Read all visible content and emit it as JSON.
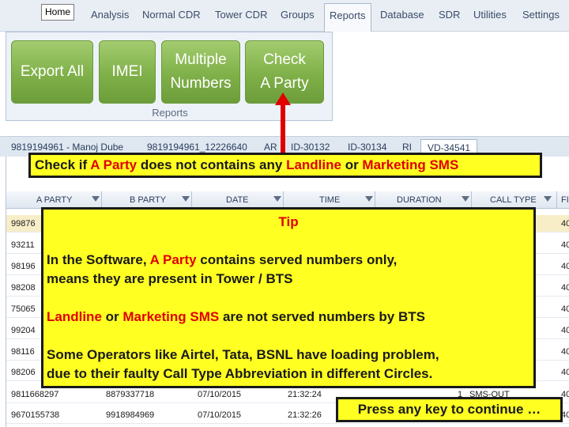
{
  "menu": {
    "home": "Home",
    "items": [
      "Analysis",
      "Normal CDR",
      "Tower CDR",
      "Groups",
      "Reports",
      "Database",
      "SDR",
      "Utilities",
      "Settings"
    ]
  },
  "ribbon": {
    "buttons": [
      {
        "line1": "Export All",
        "line2": ""
      },
      {
        "line1": "IMEI",
        "line2": ""
      },
      {
        "line1": "Multiple",
        "line2": "Numbers"
      },
      {
        "line1": "Check",
        "line2": "A Party"
      }
    ],
    "group_label": "Reports"
  },
  "record_tabs": [
    "9819194961 - Manoj Dube",
    "9819194961_12226640",
    "AR",
    "ID-30132",
    "ID-30134",
    "RI",
    "VD-34541"
  ],
  "grid": {
    "columns": [
      "A PARTY",
      "B PARTY",
      "DATE",
      "TIME",
      "DURATION",
      "CALL TYPE",
      "FI"
    ],
    "rows": [
      {
        "a": "99876",
        "b": "",
        "date": "",
        "time": "",
        "dur": "",
        "type": "",
        "f": "40"
      },
      {
        "a": "93211",
        "b": "",
        "date": "",
        "time": "",
        "dur": "",
        "type": "",
        "f": "40"
      },
      {
        "a": "98196",
        "b": "",
        "date": "",
        "time": "",
        "dur": "",
        "type": "",
        "f": "40"
      },
      {
        "a": "98208",
        "b": "",
        "date": "",
        "time": "",
        "dur": "",
        "type": "",
        "f": "40"
      },
      {
        "a": "75065",
        "b": "",
        "date": "",
        "time": "",
        "dur": "",
        "type": "",
        "f": "40"
      },
      {
        "a": "99204",
        "b": "",
        "date": "",
        "time": "",
        "dur": "",
        "type": "",
        "f": "40"
      },
      {
        "a": "98116",
        "b": "",
        "date": "",
        "time": "",
        "dur": "",
        "type": "",
        "f": "40"
      },
      {
        "a": "98206",
        "b": "",
        "date": "",
        "time": "",
        "dur": "",
        "type": "",
        "f": "40"
      },
      {
        "a": "9811668297",
        "b": "8879337718",
        "date": "07/10/2015",
        "time": "21:32:24",
        "dur": "1",
        "type": "SMS-OUT",
        "f": "40"
      },
      {
        "a": "9670155738",
        "b": "9918984969",
        "date": "07/10/2015",
        "time": "21:32:26",
        "dur": "",
        "type": "",
        "f": "40"
      }
    ]
  },
  "banner": {
    "p1": "Check if ",
    "p2": "A Party",
    "p3": " does not contains any ",
    "p4": "Landline",
    "p5": " or ",
    "p6": "Marketing SMS"
  },
  "tip": {
    "title": "Tip",
    "l1a": "In the Software, ",
    "l1b": "A Party",
    "l1c": " contains served numbers only,",
    "l2": "means they are present in Tower / BTS",
    "l3a": "Landline",
    "l3b": " or ",
    "l3c": "Marketing SMS",
    "l3d": " are not served numbers by BTS",
    "l4": "Some Operators like Airtel, Tata, BSNL have loading problem,",
    "l5": "due to their faulty Call Type Abbreviation in different Circles."
  },
  "continue_label": "Press any key to continue …",
  "colors": {
    "highlight": "#ffff22",
    "accent_red": "#e00000",
    "ribbon_green": "#7fb049"
  }
}
